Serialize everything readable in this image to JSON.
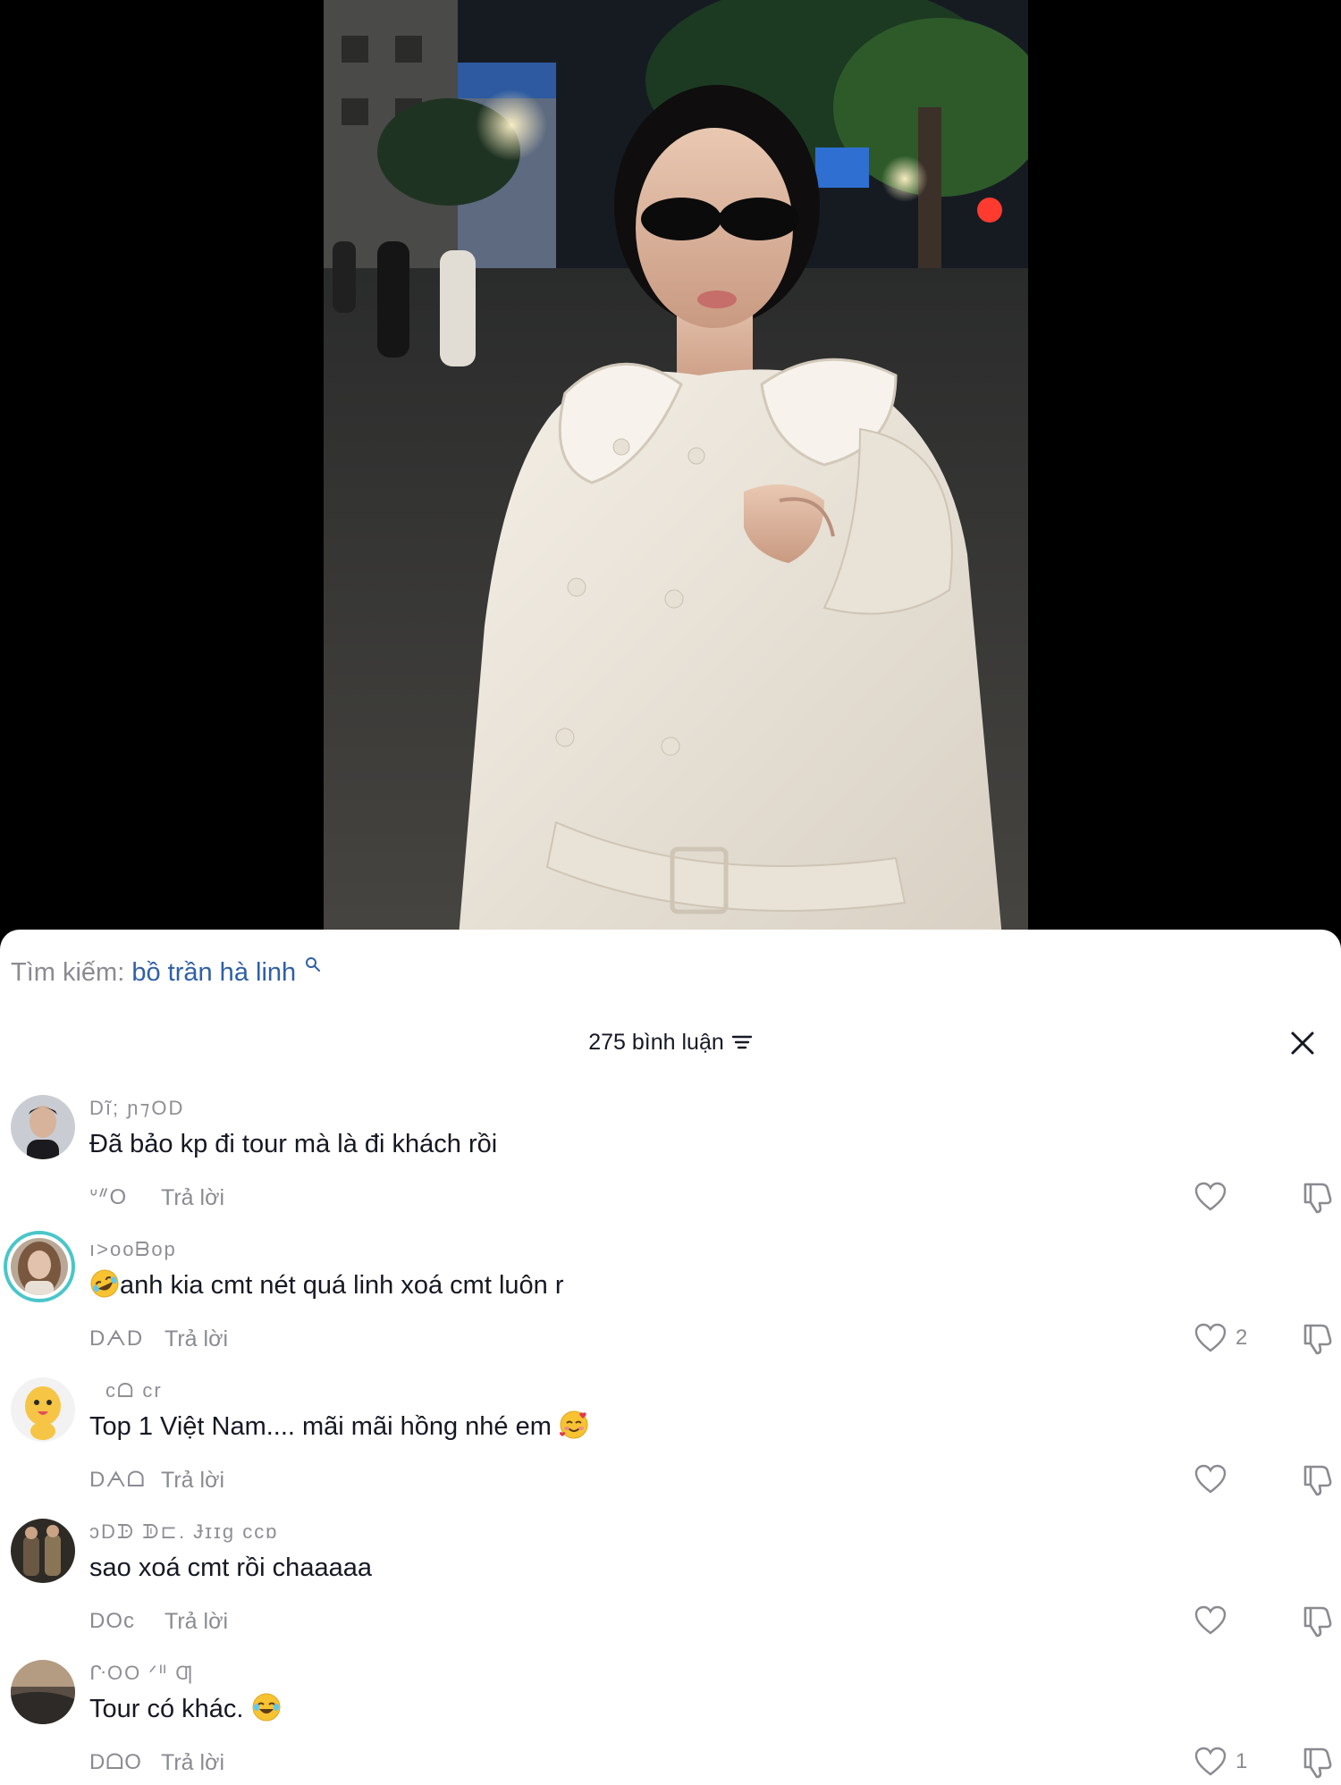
{
  "search": {
    "prefix": "Tìm kiếm:",
    "term": "bồ trần hà linh"
  },
  "header": {
    "comment_count": "275 bình luận"
  },
  "icons": {
    "search": "search-icon",
    "sort": "sort-icon",
    "close": "close-icon",
    "like": "heart-icon",
    "dislike": "thumbs-down-icon"
  },
  "colors": {
    "search_term": "#2f5fa6",
    "muted": "#8a8b91",
    "text": "#161823",
    "avatar_ring": "#4ac6c9"
  },
  "comments": [
    {
      "username": "Dĩ; ɲ⁊OD",
      "text": "Đã bảo kp đi tour mà là đi khách rồi",
      "time": "ᐡᐥO",
      "reply_label": "Trả lời",
      "likes": ""
    },
    {
      "username": "ı>ooᗷop",
      "text": "anh kia cmt nét quá linh xoá cmt luôn r",
      "leading_emoji": "rofl",
      "time": "DᗅD",
      "reply_label": "Trả lời",
      "likes": "2"
    },
    {
      "username": "cᗝ  cr",
      "text": "Top 1 Việt Nam.... mãi mãi hồng nhé em",
      "trailing_emoji": "smiling-face-with-hearts",
      "time": "Dᗅᗝ",
      "reply_label": "Trả lời",
      "likes": ""
    },
    {
      "username": "ɔDᗬ  ᗫ⊏. Ɉɪɪg ᴄᴄɒ",
      "text": "sao xoá cmt rồi chaaaaa",
      "time": "DOc",
      "reply_label": "Trả lời",
      "likes": ""
    },
    {
      "username": "ᒕOO   ᐟᐦ Ƣ",
      "text": "Tour có khác.",
      "trailing_emoji": "face-with-tears-of-joy",
      "time": "DᗝO",
      "reply_label": "Trả lời",
      "likes": "1"
    }
  ]
}
